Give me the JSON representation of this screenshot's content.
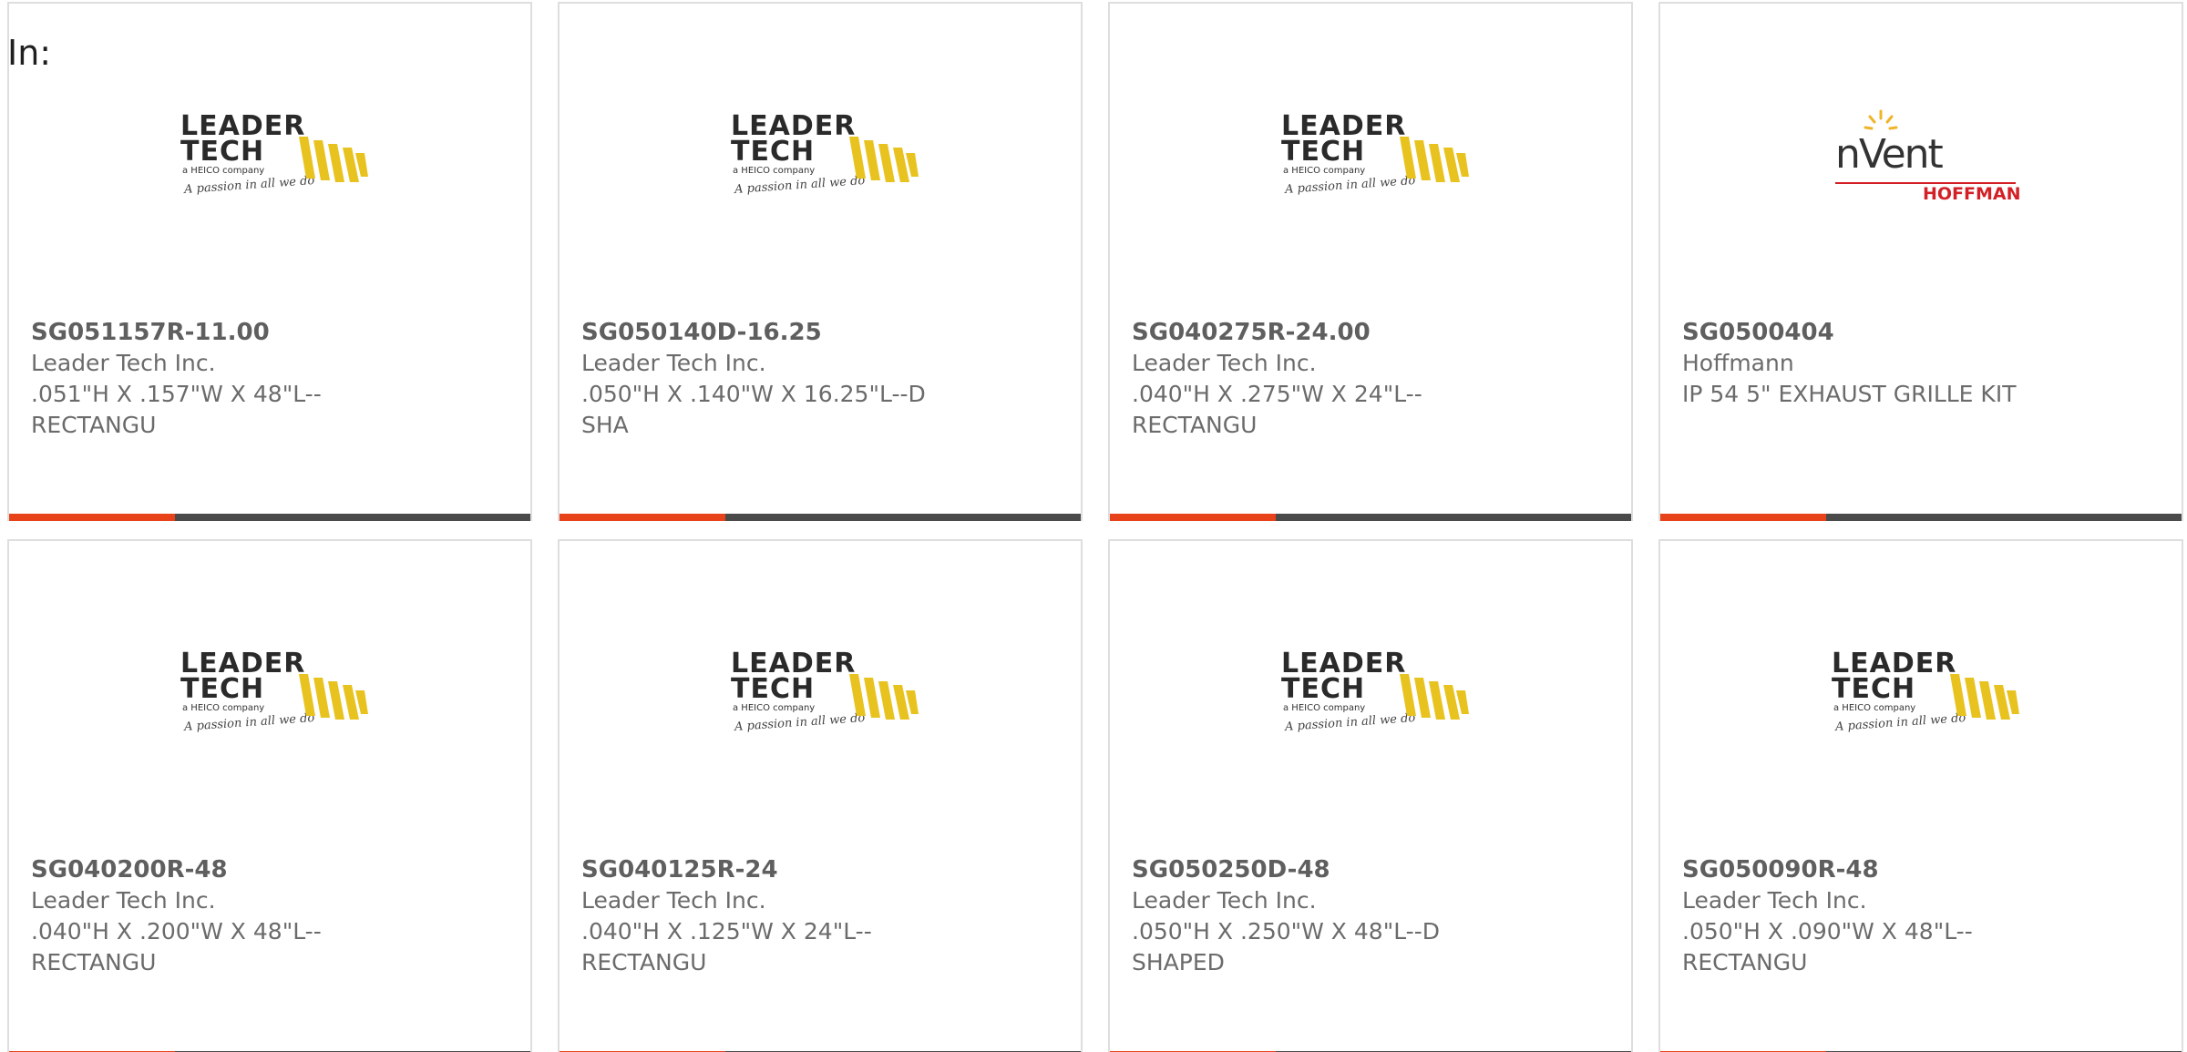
{
  "header": {
    "in_label": "In:"
  },
  "colors": {
    "accent": "#e8421a",
    "bar": "#4a4a4a",
    "border": "#dedede",
    "text_muted": "#6b6b6b",
    "nvent_red": "#d32027",
    "leader_yellow": "#e8c31f"
  },
  "logos": {
    "leader": {
      "line1": "LEADER",
      "line2": "TECH",
      "company": "a HEICO company",
      "slogan": "A passion in all we do"
    },
    "nvent": {
      "name": "nVent",
      "sub": "HOFFMAN"
    }
  },
  "products": [
    {
      "sku": "SG051157R-11.00",
      "brand": "Leader Tech Inc.",
      "description": ".051\"H X .157\"W X 48\"L--\nRECTANGU",
      "logo": "leader"
    },
    {
      "sku": "SG050140D-16.25",
      "brand": "Leader Tech Inc.",
      "description": ".050\"H X .140\"W X 16.25\"L--D\nSHA",
      "logo": "leader"
    },
    {
      "sku": "SG040275R-24.00",
      "brand": "Leader Tech Inc.",
      "description": ".040\"H X .275\"W X 24\"L--\nRECTANGU",
      "logo": "leader"
    },
    {
      "sku": "SG0500404",
      "brand": "Hoffmann",
      "description": "IP 54 5\" EXHAUST GRILLE KIT",
      "logo": "nvent"
    },
    {
      "sku": "SG040200R-48",
      "brand": "Leader Tech Inc.",
      "description": ".040\"H X .200\"W X 48\"L--\nRECTANGU",
      "logo": "leader"
    },
    {
      "sku": "SG040125R-24",
      "brand": "Leader Tech Inc.",
      "description": ".040\"H X .125\"W X 24\"L--\nRECTANGU",
      "logo": "leader"
    },
    {
      "sku": "SG050250D-48",
      "brand": "Leader Tech Inc.",
      "description": ".050\"H X .250\"W X 48\"L--D\nSHAPED",
      "logo": "leader"
    },
    {
      "sku": "SG050090R-48",
      "brand": "Leader Tech Inc.",
      "description": ".050\"H X .090\"W X 48\"L--\nRECTANGU",
      "logo": "leader"
    }
  ]
}
